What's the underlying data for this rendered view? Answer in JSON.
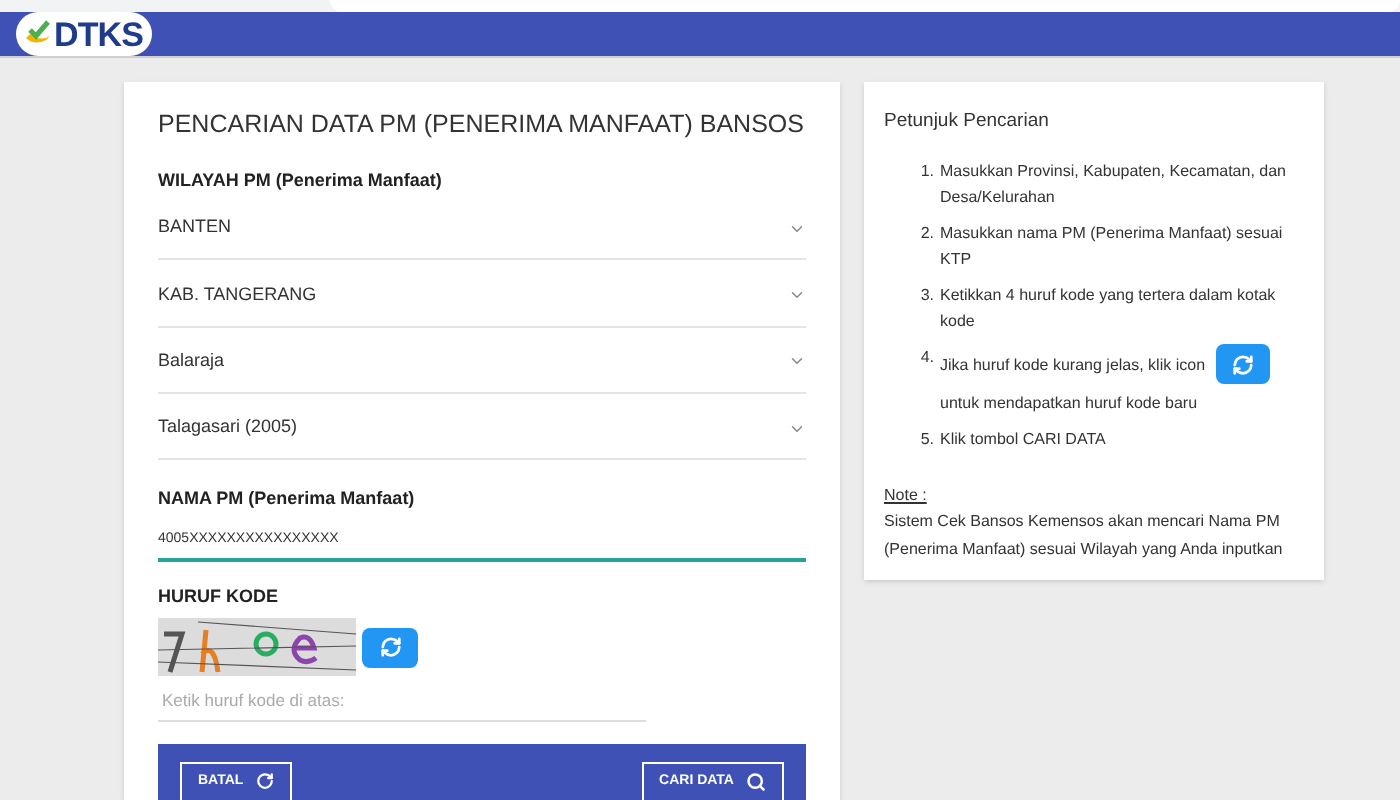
{
  "header": {
    "logo_text": "DTKS"
  },
  "search_form": {
    "title": "PENCARIAN DATA PM (PENERIMA MANFAAT) BANSOS",
    "region_label": "WILAYAH PM (Penerima Manfaat)",
    "selects": [
      {
        "value": "BANTEN"
      },
      {
        "value": "KAB. TANGERANG"
      },
      {
        "value": "Balaraja"
      },
      {
        "value": "Talagasari (2005)"
      }
    ],
    "name_label": "NAMA PM (Penerima Manfaat)",
    "name_value": "4005XXXXXXXXXXXXXXXX",
    "code_label": "HURUF KODE",
    "code_placeholder": "Ketik huruf kode di atas:",
    "buttons": [
      {
        "label": "BATAL",
        "kind": "reset"
      },
      {
        "label": "CARI DATA",
        "kind": "search"
      }
    ]
  },
  "instructions": {
    "title": "Petunjuk Pencarian",
    "steps": [
      {
        "kind": "text",
        "number": "1.",
        "text": "Masukkan Provinsi, Kabupaten, Kecamatan, dan Desa/Kelurahan"
      },
      {
        "kind": "text",
        "number": "2.",
        "text": "Masukkan nama PM (Penerima Manfaat) sesuai KTP"
      },
      {
        "kind": "text",
        "number": "3.",
        "text": "Ketikkan 4 huruf kode yang tertera dalam kotak kode"
      },
      {
        "kind": "icon",
        "number": "4.",
        "text": "Jika huruf kode kurang jelas, klik icon",
        "after": "untuk mendapatkan huruf kode baru"
      },
      {
        "kind": "text",
        "number": "5.",
        "text": "Klik tombol CARI DATA"
      }
    ],
    "note_label": "Note :",
    "note": "Sistem Cek Bansos Kemensos akan mencari Nama PM (Penerima Manfaat) sesuai Wilayah yang Anda inputkan"
  }
}
